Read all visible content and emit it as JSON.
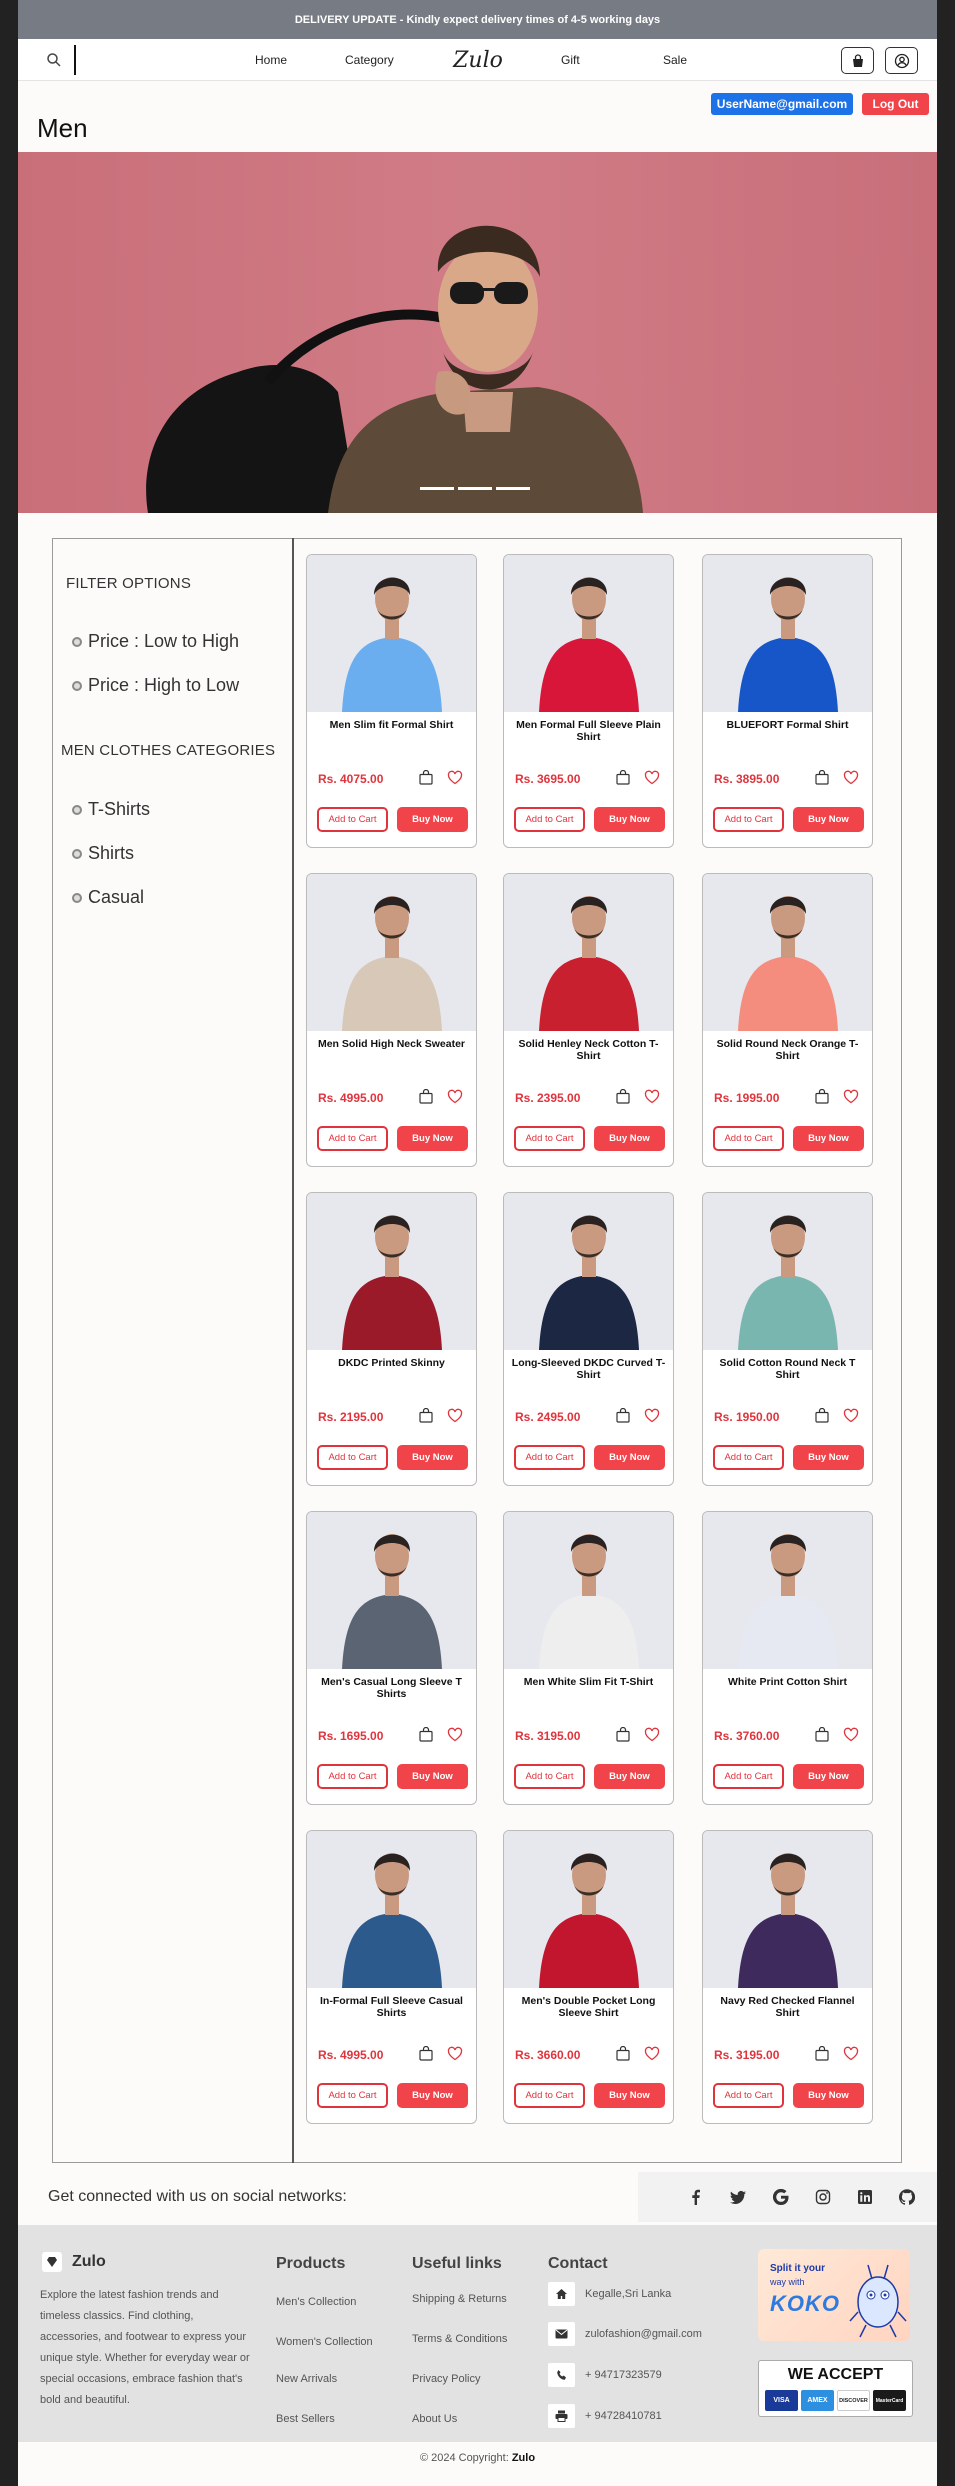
{
  "banner": {
    "text": "DELIVERY UPDATE - Kindly expect delivery times of 4-5 working days"
  },
  "nav": {
    "links": [
      "Home",
      "Category",
      "Gift",
      "Sale"
    ],
    "logo": "Zulo",
    "user_email": "UserName@gmail.com",
    "logout_label": "Log Out",
    "icons": [
      "search-icon",
      "shopping-bag-icon",
      "user-icon"
    ]
  },
  "page": {
    "title": "Men"
  },
  "hero": {
    "slides": 3
  },
  "filters": {
    "heading": "FILTER OPTIONS",
    "price_options": [
      "Price : Low to High",
      "Price : High to Low"
    ],
    "categories_heading": "MEN CLOTHES CATEGORIES",
    "categories": [
      "T-Shirts",
      "Shirts",
      "Casual"
    ]
  },
  "product_buttons": {
    "cart": "Add to Cart",
    "buy": "Buy Now"
  },
  "products": [
    {
      "name": "Men Slim fit Formal Shirt",
      "price": "Rs. 4075.00",
      "color": "#6aaef0"
    },
    {
      "name": "Men Formal Full Sleeve Plain Shirt",
      "price": "Rs. 3695.00",
      "color": "#d8163a"
    },
    {
      "name": "BLUEFORT Formal Shirt",
      "price": "Rs. 3895.00",
      "color": "#1656c9"
    },
    {
      "name": "Men Solid High Neck Sweater",
      "price": "Rs. 4995.00",
      "color": "#d8c8b8"
    },
    {
      "name": "Solid Henley Neck Cotton T-Shirt",
      "price": "Rs. 2395.00",
      "color": "#c8202e"
    },
    {
      "name": "Solid Round Neck Orange T-Shirt",
      "price": "Rs. 1995.00",
      "color": "#f48d7d"
    },
    {
      "name": "DKDC Printed Skinny",
      "price": "Rs. 2195.00",
      "color": "#9a1a2a"
    },
    {
      "name": "Long-Sleeved DKDC Curved T-Shirt",
      "price": "Rs. 2495.00",
      "color": "#1c2744"
    },
    {
      "name": "Solid Cotton Round Neck T Shirt",
      "price": "Rs. 1950.00",
      "color": "#79b6b0"
    },
    {
      "name": "Men's Casual Long Sleeve T Shirts",
      "price": "Rs. 1695.00",
      "color": "#5b6472"
    },
    {
      "name": "Men White Slim Fit T-Shirt",
      "price": "Rs. 3195.00",
      "color": "#eeeeee"
    },
    {
      "name": "White Print Cotton Shirt",
      "price": "Rs. 3760.00",
      "color": "#e6e9f2"
    },
    {
      "name": "In-Formal Full Sleeve Casual Shirts",
      "price": "Rs. 4995.00",
      "color": "#2c5a8c"
    },
    {
      "name": "Men's Double Pocket Long Sleeve Shirt",
      "price": "Rs. 3660.00",
      "color": "#c1162e"
    },
    {
      "name": "Navy Red Checked Flannel Shirt",
      "price": "Rs. 3195.00",
      "color": "#3e2a5c"
    }
  ],
  "social": {
    "text": "Get connected with us on social networks:",
    "icons": [
      "facebook-icon",
      "twitter-icon",
      "google-icon",
      "instagram-icon",
      "linkedin-icon",
      "github-icon"
    ]
  },
  "footer": {
    "brand": "Zulo",
    "description": "Explore the latest fashion trends and timeless classics. Find clothing, accessories, and footwear to express your unique style. Whether for everyday wear or special occasions, embrace fashion that's bold and beautiful.",
    "products_heading": "Products",
    "products": [
      "Men's Collection",
      "Women's Collection",
      "New Arrivals",
      "Best Sellers"
    ],
    "useful_heading": "Useful links",
    "useful": [
      "Shipping & Returns",
      "Terms & Conditions",
      "Privacy Policy",
      "About Us"
    ],
    "contact_heading": "Contact",
    "contact": [
      "Kegalle,Sri Lanka",
      "zulofashion@gmail.com",
      "+ 94717323579",
      "+ 94728410781"
    ],
    "koko": {
      "line1": "Split it your",
      "line2": "way with",
      "logo": "KOKO"
    },
    "accept": {
      "title": "WE ACCEPT",
      "cards": [
        "VISA",
        "AMEX",
        "DISCOVER",
        "MasterCard"
      ]
    }
  },
  "copyright": {
    "prefix": "© 2024 Copyright:",
    "brand": "Zulo"
  }
}
